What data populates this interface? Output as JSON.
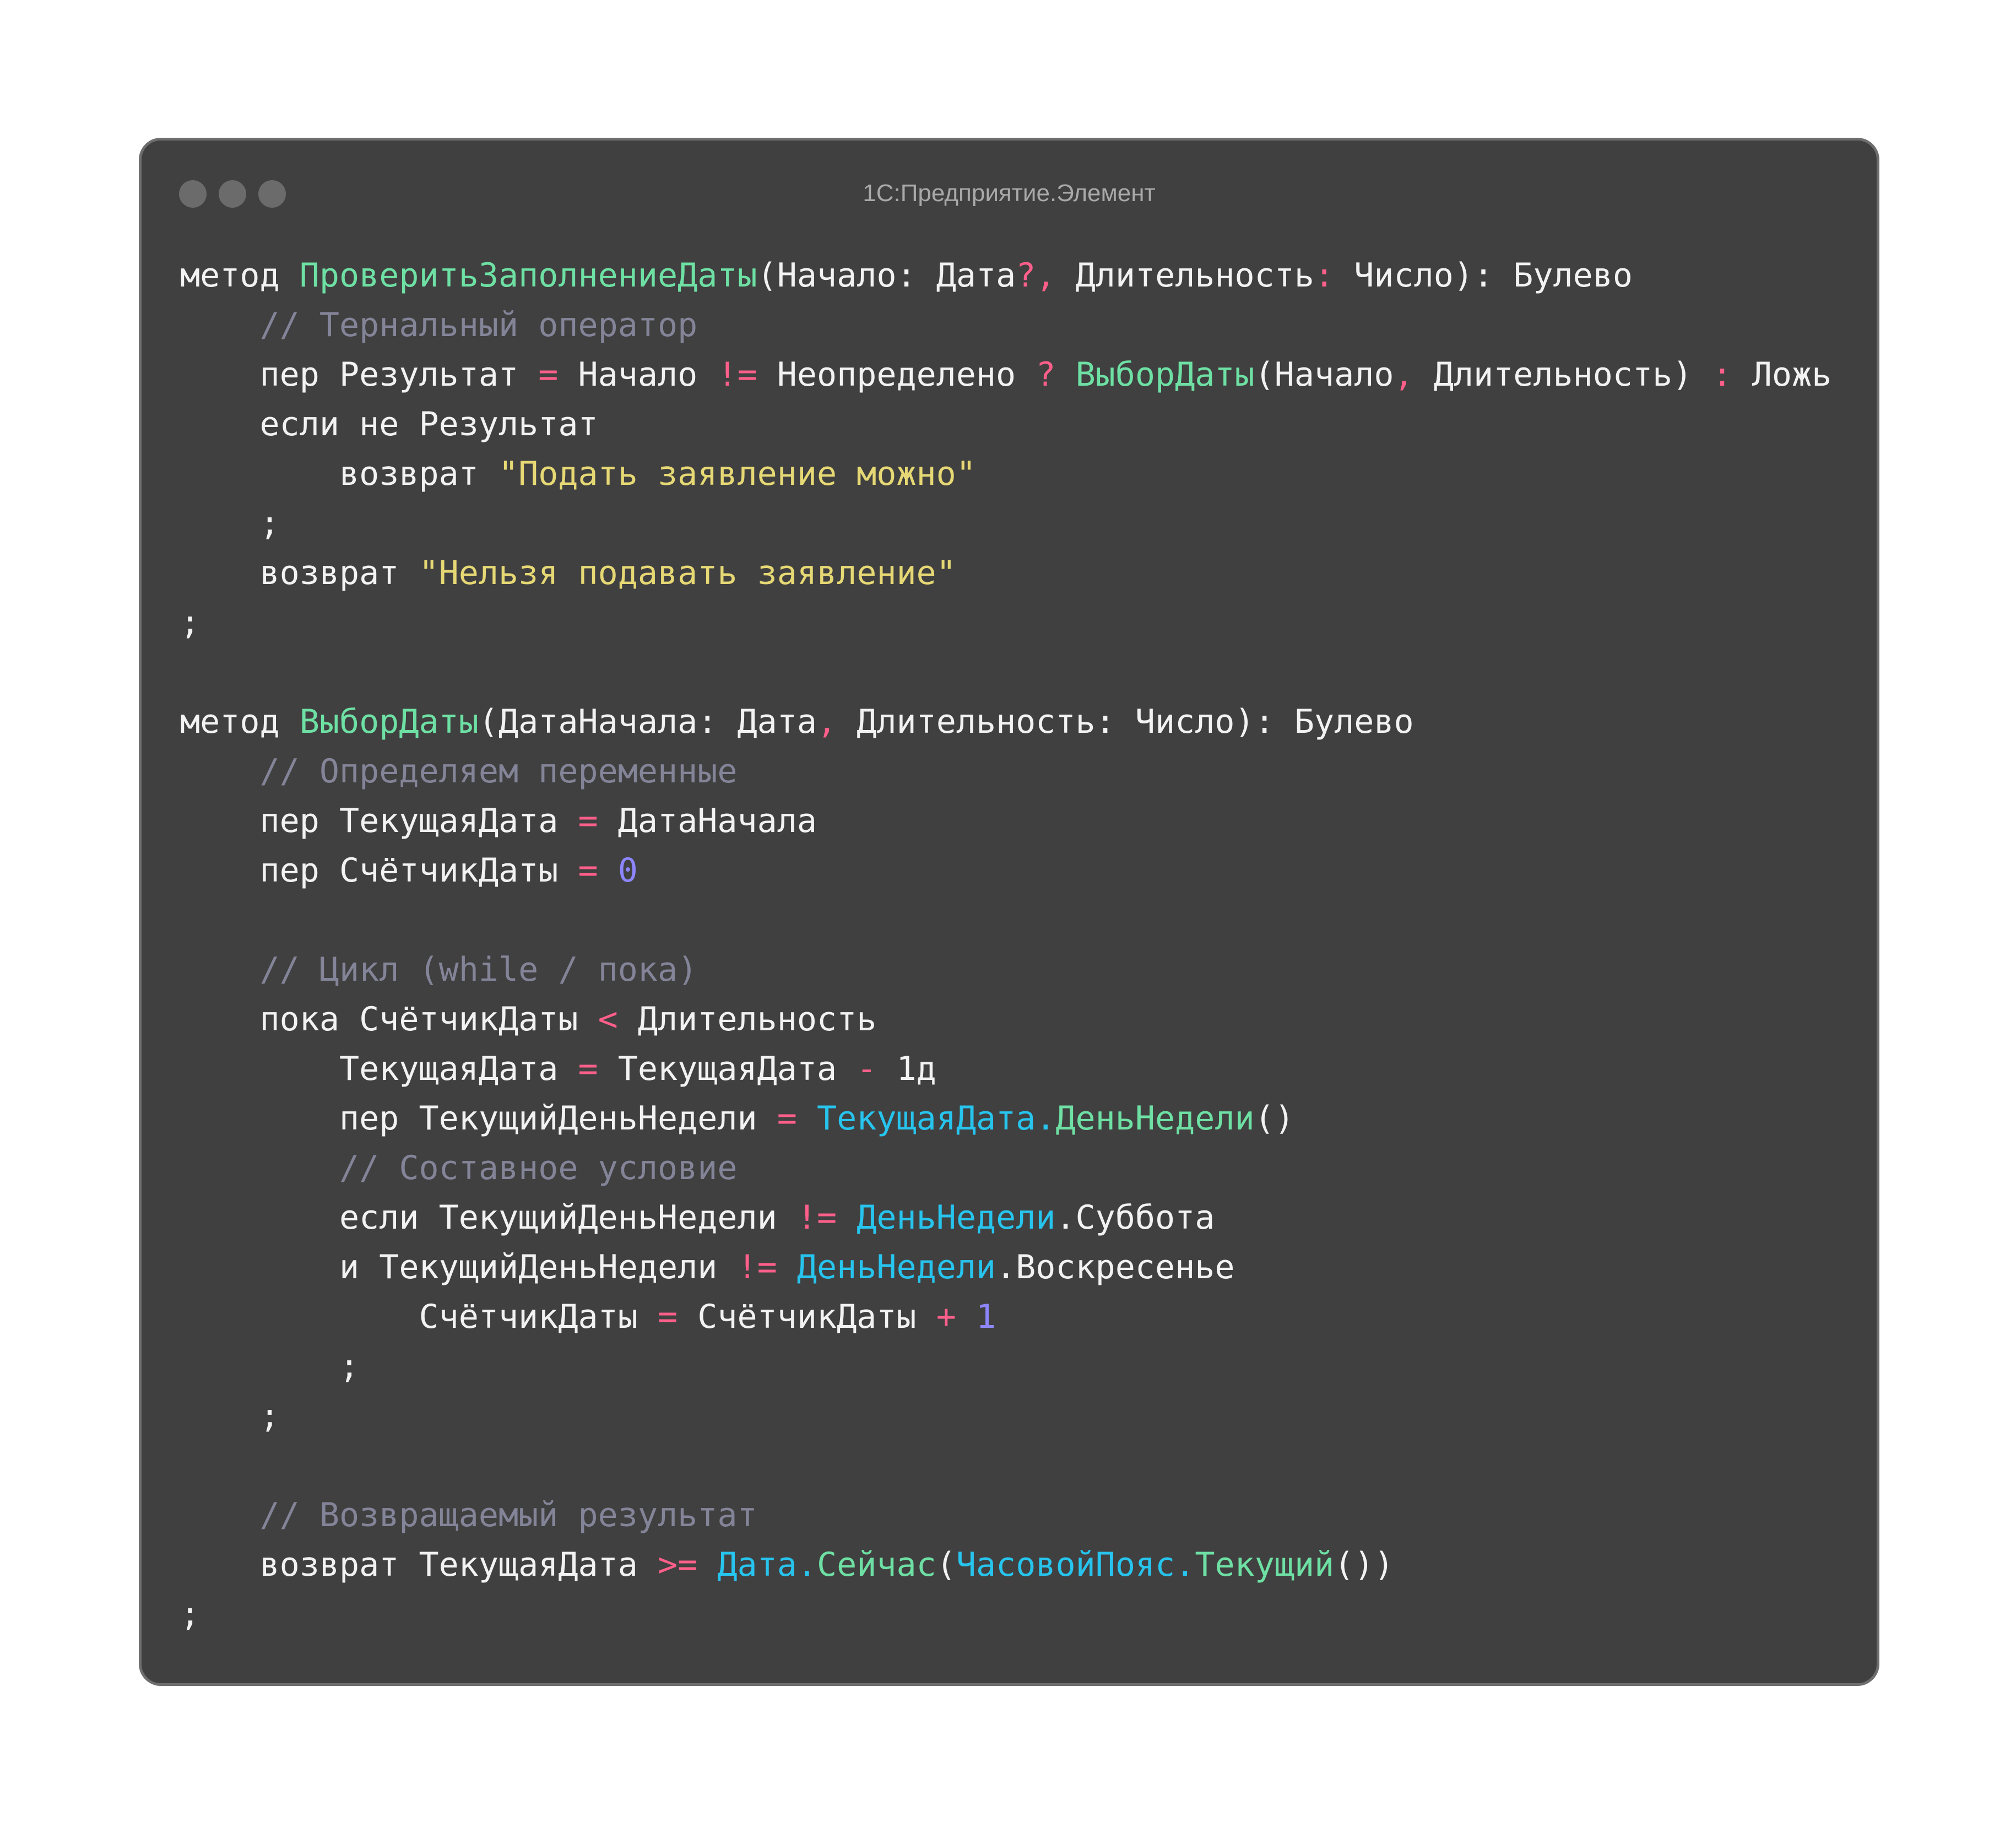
{
  "window": {
    "title": "1С:Предприятие.Элемент",
    "controls": [
      "close-dot",
      "minimize-dot",
      "zoom-dot"
    ]
  },
  "colors": {
    "background": "#404040",
    "keyword": "#f2f2f2",
    "function": "#6ee0a4",
    "operator": "#ff5f8a",
    "string": "#e6d874",
    "number": "#8d86ff",
    "comment": "#848499",
    "type": "#27c4ee"
  },
  "code_lines": [
    [
      [
        "kw",
        "метод "
      ],
      [
        "fn",
        "ПроверитьЗаполнениеДаты"
      ],
      [
        "plain",
        "(Начало: Дата"
      ],
      [
        "op",
        "?,"
      ],
      [
        "plain",
        " Длительность"
      ],
      [
        "op",
        ":"
      ],
      [
        "plain",
        " Число): Булево"
      ]
    ],
    [
      [
        "plain",
        "    "
      ],
      [
        "cm",
        "// Тернальный оператор"
      ]
    ],
    [
      [
        "kw",
        "    пер "
      ],
      [
        "plain",
        "Результат "
      ],
      [
        "op",
        "="
      ],
      [
        "plain",
        " Начало "
      ],
      [
        "op",
        "!="
      ],
      [
        "plain",
        " Неопределено "
      ],
      [
        "op",
        "?"
      ],
      [
        "plain",
        " "
      ],
      [
        "fn",
        "ВыборДаты"
      ],
      [
        "plain",
        "(Начало"
      ],
      [
        "op",
        ","
      ],
      [
        "plain",
        " Длительность) "
      ],
      [
        "op",
        ":"
      ],
      [
        "plain",
        " Ложь"
      ]
    ],
    [
      [
        "kw",
        "    если не "
      ],
      [
        "plain",
        "Результат"
      ]
    ],
    [
      [
        "kw",
        "        возврат "
      ],
      [
        "str",
        "\"Подать заявление можно\""
      ]
    ],
    [
      [
        "plain",
        "    ;"
      ]
    ],
    [
      [
        "kw",
        "    возврат "
      ],
      [
        "str",
        "\"Нельзя подавать заявление\""
      ]
    ],
    [
      [
        "plain",
        ";"
      ]
    ],
    [
      [
        "plain",
        ""
      ]
    ],
    [
      [
        "kw",
        "метод "
      ],
      [
        "fn",
        "ВыборДаты"
      ],
      [
        "plain",
        "(ДатаНачала: Дата"
      ],
      [
        "op",
        ","
      ],
      [
        "plain",
        " Длительность: Число): Булево"
      ]
    ],
    [
      [
        "plain",
        "    "
      ],
      [
        "cm",
        "// Определяем переменные"
      ]
    ],
    [
      [
        "kw",
        "    пер "
      ],
      [
        "plain",
        "ТекущаяДата "
      ],
      [
        "op",
        "="
      ],
      [
        "plain",
        " ДатаНачала"
      ]
    ],
    [
      [
        "kw",
        "    пер "
      ],
      [
        "plain",
        "СчётчикДаты "
      ],
      [
        "op",
        "="
      ],
      [
        "plain",
        " "
      ],
      [
        "num",
        "0"
      ]
    ],
    [
      [
        "plain",
        ""
      ]
    ],
    [
      [
        "plain",
        "    "
      ],
      [
        "cm",
        "// Цикл (while / пока)"
      ]
    ],
    [
      [
        "kw",
        "    пока "
      ],
      [
        "plain",
        "СчётчикДаты "
      ],
      [
        "op",
        "<"
      ],
      [
        "plain",
        " Длительность"
      ]
    ],
    [
      [
        "plain",
        "        ТекущаяДата "
      ],
      [
        "op",
        "="
      ],
      [
        "plain",
        " ТекущаяДата "
      ],
      [
        "op",
        "-"
      ],
      [
        "plain",
        " 1д"
      ]
    ],
    [
      [
        "kw",
        "        пер "
      ],
      [
        "plain",
        "ТекущийДеньНедели "
      ],
      [
        "op",
        "="
      ],
      [
        "plain",
        " "
      ],
      [
        "ty",
        "ТекущаяДата."
      ],
      [
        "fn",
        "ДеньНедели"
      ],
      [
        "plain",
        "()"
      ]
    ],
    [
      [
        "plain",
        "        "
      ],
      [
        "cm",
        "// Составное условие"
      ]
    ],
    [
      [
        "kw",
        "        если "
      ],
      [
        "plain",
        "ТекущийДеньНедели "
      ],
      [
        "op",
        "!="
      ],
      [
        "plain",
        " "
      ],
      [
        "ty",
        "ДеньНедели"
      ],
      [
        "plain",
        ".Суббота"
      ]
    ],
    [
      [
        "kw",
        "        и "
      ],
      [
        "plain",
        "ТекущийДеньНедели "
      ],
      [
        "op",
        "!="
      ],
      [
        "plain",
        " "
      ],
      [
        "ty",
        "ДеньНедели"
      ],
      [
        "plain",
        ".Воскресенье"
      ]
    ],
    [
      [
        "plain",
        "            СчётчикДаты "
      ],
      [
        "op",
        "="
      ],
      [
        "plain",
        " СчётчикДаты "
      ],
      [
        "op",
        "+"
      ],
      [
        "plain",
        " "
      ],
      [
        "num",
        "1"
      ]
    ],
    [
      [
        "plain",
        "        ;"
      ]
    ],
    [
      [
        "plain",
        "    ;"
      ]
    ],
    [
      [
        "plain",
        ""
      ]
    ],
    [
      [
        "plain",
        "    "
      ],
      [
        "cm",
        "// Возвращаемый результат"
      ]
    ],
    [
      [
        "kw",
        "    возврат "
      ],
      [
        "plain",
        "ТекущаяДата "
      ],
      [
        "op",
        ">="
      ],
      [
        "plain",
        " "
      ],
      [
        "ty",
        "Дата."
      ],
      [
        "fn",
        "Сейчас"
      ],
      [
        "plain",
        "("
      ],
      [
        "ty",
        "ЧасовойПояс."
      ],
      [
        "fn",
        "Текущий"
      ],
      [
        "plain",
        "())"
      ]
    ],
    [
      [
        "plain",
        ";"
      ]
    ]
  ]
}
